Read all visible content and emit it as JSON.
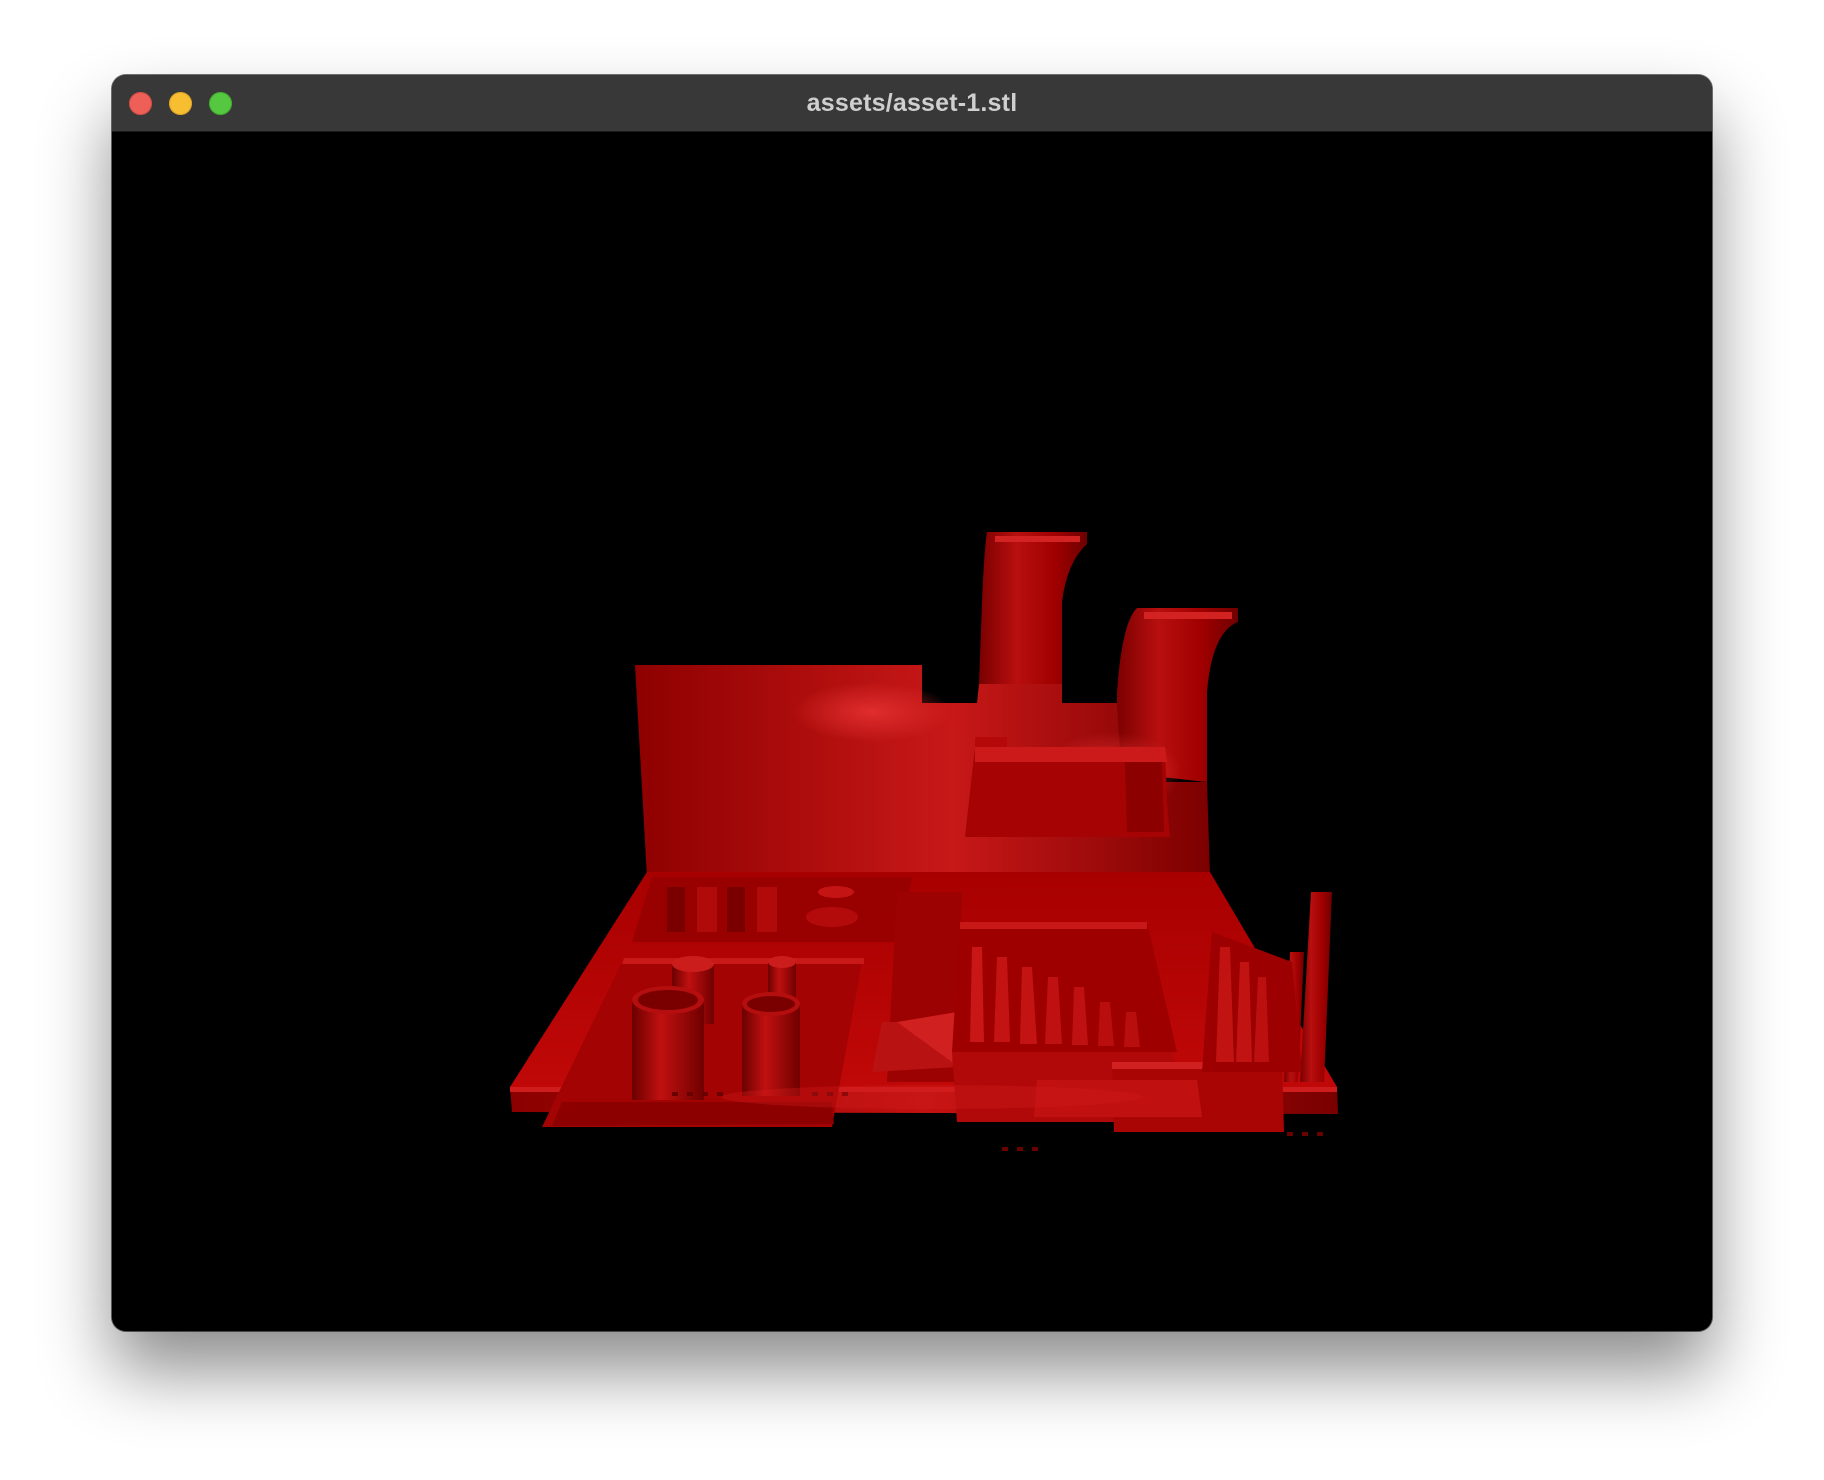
{
  "window": {
    "title": "assets/asset-1.stl",
    "controls": [
      "close",
      "minimize",
      "zoom"
    ]
  },
  "viewport": {
    "background": "#000000",
    "model": {
      "name": "STL 3D model",
      "color": "#b30000"
    }
  }
}
